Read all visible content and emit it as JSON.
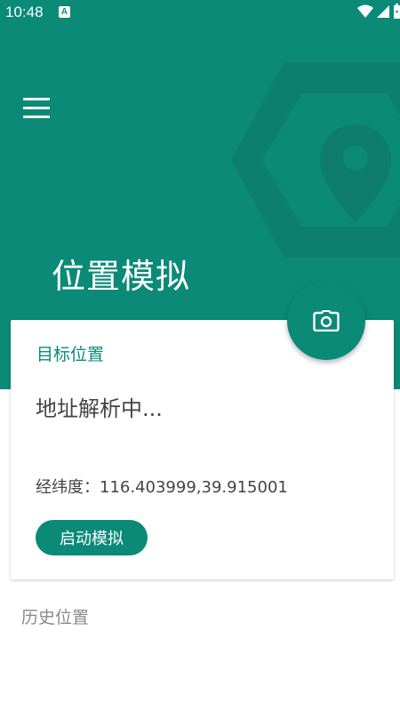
{
  "status_bar": {
    "time": "10:48",
    "notification_icon": "A"
  },
  "header": {
    "title": "位置模拟",
    "background_color": "#0b8a78",
    "menu_icon": "hamburger-menu-icon",
    "decoration_icon": "map-pin-icon"
  },
  "fab": {
    "icon": "camera-icon"
  },
  "card": {
    "section_label": "目标位置",
    "address": "地址解析中...",
    "coordinates": "经纬度：116.403999,39.915001",
    "start_button_label": "启动模拟"
  },
  "history": {
    "label": "历史位置"
  }
}
